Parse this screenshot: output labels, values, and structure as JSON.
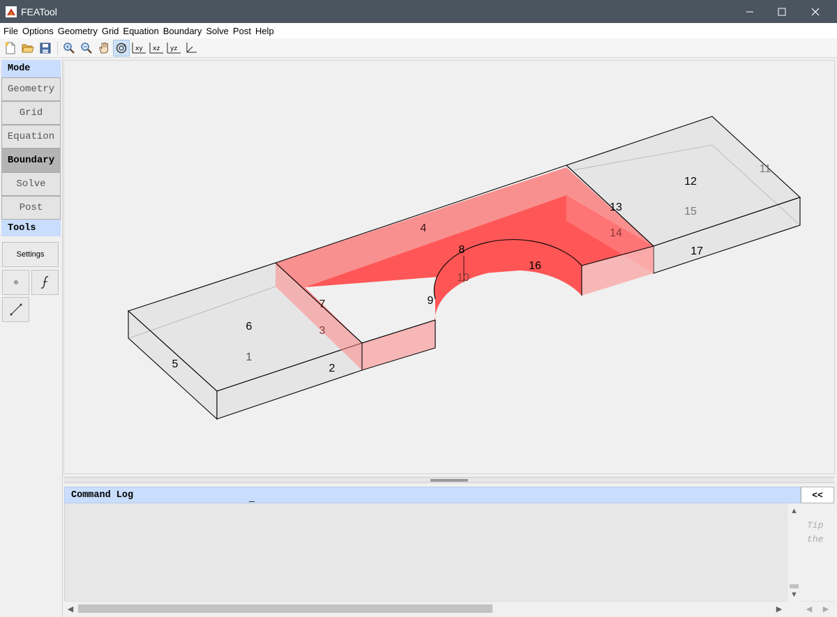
{
  "window": {
    "title": "FEATool"
  },
  "menu": [
    "File",
    "Options",
    "Geometry",
    "Grid",
    "Equation",
    "Boundary",
    "Solve",
    "Post",
    "Help"
  ],
  "toolbar": {
    "buttons": [
      "new-icon",
      "open-icon",
      "save-icon",
      "zoom-in-icon",
      "zoom-out-icon",
      "pan-icon",
      "rotate-3d-icon",
      "view-xy-icon",
      "view-xz-icon",
      "view-yz-icon",
      "view-3d-icon"
    ],
    "labels": {
      "xy": "xy",
      "xz": "xz",
      "yz": "yz"
    }
  },
  "sidebar": {
    "mode_header": "Mode",
    "modes": [
      "Geometry",
      "Grid",
      "Equation",
      "Boundary",
      "Solve",
      "Post"
    ],
    "active_mode": "Boundary",
    "tools_header": "Tools",
    "settings_label": "Settings",
    "tool_icons": [
      "point-icon",
      "function-icon",
      "line-icon"
    ]
  },
  "viewport": {
    "boundary_labels": {
      "b1": "1",
      "b2": "2",
      "b3": "3",
      "b4": "4",
      "b5": "5",
      "b6": "6",
      "b7": "7",
      "b8": "8",
      "b9": "9",
      "b10": "10",
      "b11": "11",
      "b12": "12",
      "b13": "13",
      "b14": "14",
      "b15": "15",
      "b16": "16",
      "b17": "17"
    },
    "highlight_color": "#ff3333"
  },
  "log": {
    "header": "Command Log",
    "collapse_label": "<<",
    "tip_lines": [
      "Tip",
      "the"
    ]
  }
}
